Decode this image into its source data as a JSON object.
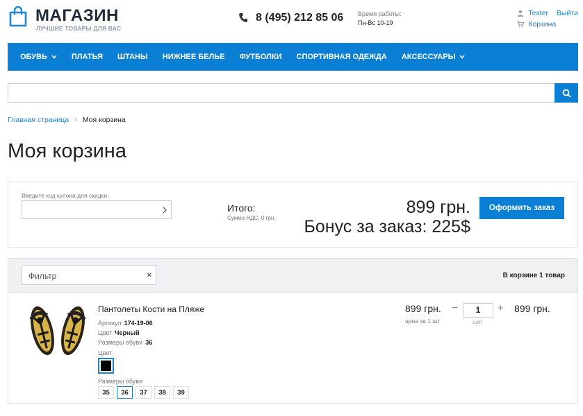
{
  "header": {
    "logo_title": "МАГАЗИН",
    "logo_subtitle": "ЛУЧШИЕ ТОВАРЫ ДЛЯ ВАС",
    "phone": "8 (495) 212 85 06",
    "hours_label": "Время работы:",
    "hours_value": "Пн-Вс 10-19",
    "user_name": "Tester",
    "logout": "Выйти",
    "cart_link": "Корзина"
  },
  "nav": {
    "items": [
      {
        "label": "ОБУВЬ",
        "has_dropdown": true
      },
      {
        "label": "ПЛАТЬЯ"
      },
      {
        "label": "ШТАНЫ"
      },
      {
        "label": "НИЖНЕЕ БЕЛЬЕ"
      },
      {
        "label": "ФУТБОЛКИ"
      },
      {
        "label": "СПОРТИВНАЯ ОДЕЖДА"
      },
      {
        "label": "АКСЕССУАРЫ",
        "has_dropdown": true
      }
    ]
  },
  "search": {
    "value": "",
    "placeholder": ""
  },
  "breadcrumb": {
    "home": "Главная страница",
    "separator": "›",
    "current": "Моя корзина"
  },
  "page_title": "Моя корзина",
  "summary": {
    "coupon_label": "Введите код купона для скидки:",
    "coupon_value": "",
    "total_label": "Итого:",
    "vat": "Сумма НДС: 0 грн.",
    "total_price": "899 грн.",
    "bonus": "Бонус за заказ: 225$",
    "order_button": "Оформить заказ"
  },
  "cart": {
    "filter_value": "Фильтр",
    "filter_clear": "×",
    "count_text": "В корзине 1 товар",
    "items": [
      {
        "name": "Пантолеты Кости на Пляже",
        "article_label": "Артикул",
        "article": "174-19-06",
        "color_label": "Цвет",
        "color": "Черный",
        "size_label": "Размеры обуви",
        "size": "36",
        "color_picker_label": "Цвет",
        "sizes_picker_label": "Размеры обуви",
        "sizes": [
          "35",
          "36",
          "37",
          "38",
          "39"
        ],
        "selected_size": "36",
        "unit_price": "899 грн.",
        "unit_note": "цена за 1 шт",
        "quantity": "1",
        "quantity_unit": "шт",
        "line_total": "899 грн."
      }
    ]
  },
  "colors": {
    "accent": "#0a7fd3",
    "link": "#1e84d0"
  }
}
